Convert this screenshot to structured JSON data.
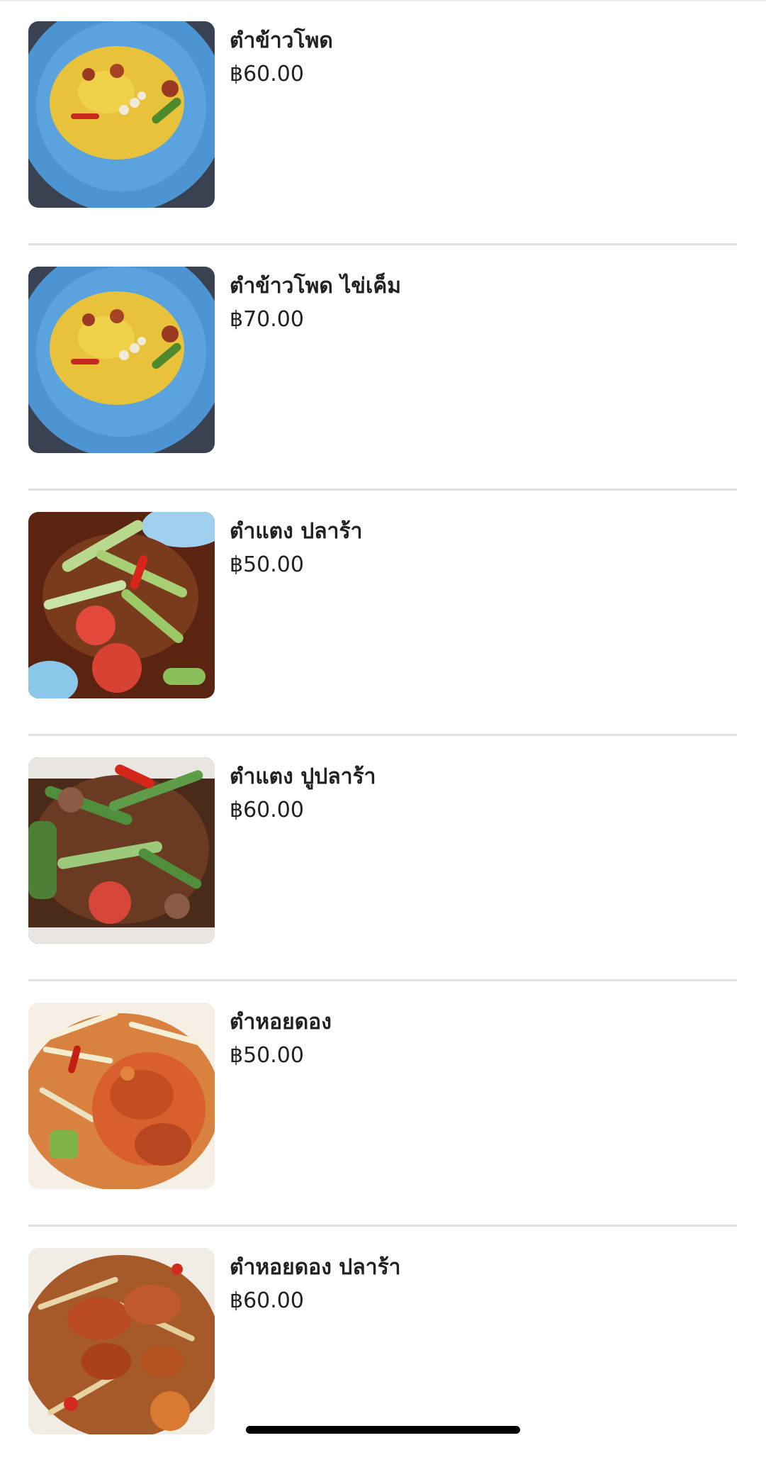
{
  "menu": {
    "items": [
      {
        "name": "ตำข้าวโพด",
        "price": "฿60.00",
        "image": "corn-salad-photo"
      },
      {
        "name": "ตำข้าวโพด ไข่เค็ม",
        "price": "฿70.00",
        "image": "corn-salad-salted-egg-photo"
      },
      {
        "name": "ตำแตง ปลาร้า",
        "price": "฿50.00",
        "image": "cucumber-salad-pla-ra-photo"
      },
      {
        "name": "ตำแตง ปูปลาร้า",
        "price": "฿60.00",
        "image": "cucumber-salad-crab-pla-ra-photo"
      },
      {
        "name": "ตำหอยดอง",
        "price": "฿50.00",
        "image": "pickled-clam-salad-photo"
      },
      {
        "name": "ตำหอยดอง ปลาร้า",
        "price": "฿60.00",
        "image": "pickled-clam-salad-pla-ra-photo"
      }
    ]
  },
  "colors": {
    "background": "#ffffff",
    "text": "#222222",
    "divider": "#e2e2e2",
    "plate_blue": "#4f9ad8"
  }
}
